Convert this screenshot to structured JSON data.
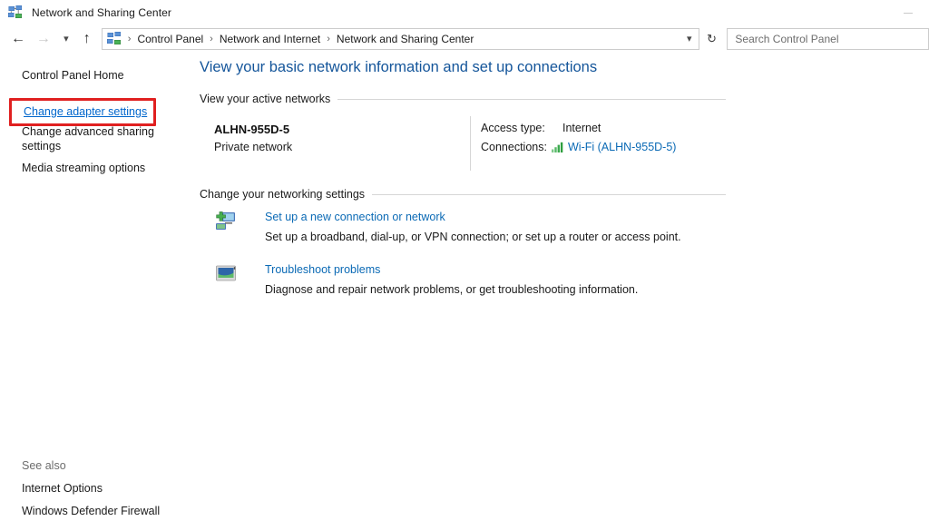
{
  "window": {
    "title": "Network and Sharing Center",
    "icon": "network-sharing-icon",
    "minimize_label": "—"
  },
  "navbar": {
    "back_icon": "back-arrow-icon",
    "forward_icon": "forward-arrow-icon",
    "recent_icon": "chevron-down-icon",
    "up_icon": "up-arrow-icon",
    "address_icon": "network-sharing-icon",
    "breadcrumbs": [
      "Control Panel",
      "Network and Internet",
      "Network and Sharing Center"
    ],
    "separator": "›",
    "dropdown_icon": "chevron-down-icon",
    "refresh_icon": "refresh-icon",
    "refresh_glyph": "↻",
    "search": {
      "placeholder": "Search Control Panel",
      "value": ""
    }
  },
  "sidebar": {
    "home_label": "Control Panel Home",
    "items": [
      {
        "label": "Change adapter settings",
        "state": "highlighted-hover"
      },
      {
        "label": "Change advanced sharing settings",
        "state": "normal"
      },
      {
        "label": "Media streaming options",
        "state": "normal"
      }
    ],
    "see_also": {
      "title": "See also",
      "items": [
        "Internet Options",
        "Windows Defender Firewall"
      ]
    }
  },
  "main": {
    "page_title": "View your basic network information and set up connections",
    "sections": [
      {
        "heading": "View your active networks"
      },
      {
        "heading": "Change your networking settings"
      }
    ],
    "active_network": {
      "name": "ALHN-955D-5",
      "type": "Private network",
      "details": [
        {
          "label": "Access type:",
          "value": "Internet"
        },
        {
          "label": "Connections:",
          "value": "Wi-Fi (ALHN-955D-5)",
          "icon": "wifi-signal-icon"
        }
      ]
    },
    "tasks": [
      {
        "icon": "new-connection-icon",
        "link": "Set up a new connection or network",
        "description": "Set up a broadband, dial-up, or VPN connection; or set up a router or access point."
      },
      {
        "icon": "troubleshoot-icon",
        "link": "Troubleshoot problems",
        "description": "Diagnose and repair network problems, or get troubleshooting information."
      }
    ]
  },
  "colors": {
    "title_blue": "#14559a",
    "link_blue": "#0b6ab5",
    "hover_link_blue": "#0066cc",
    "highlight_red": "#e02020",
    "signal_green": "#2e9e3e"
  }
}
